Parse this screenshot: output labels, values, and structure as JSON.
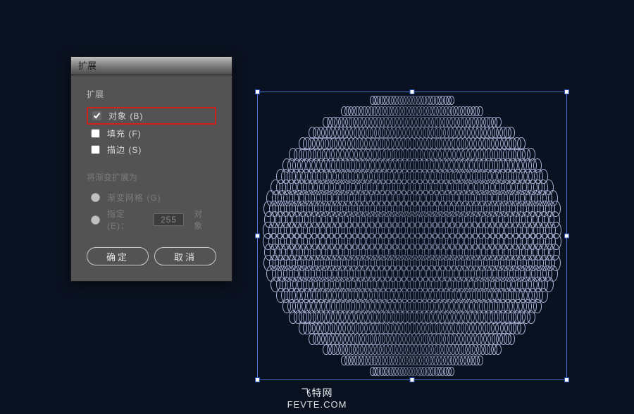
{
  "dialog": {
    "title": "扩展",
    "section1_label": "扩展",
    "object_label": "对象 (B)",
    "fill_label": "填充 (F)",
    "stroke_label": "描边 (S)",
    "section2_label": "将渐变扩展为",
    "gradient_mesh_label": "渐变网格 (G)",
    "specify_prefix": "指定 (E)：",
    "specify_value": "255",
    "specify_suffix": "对象",
    "ok": "确定",
    "cancel": "取消"
  },
  "artwork": {
    "rows": 26
  },
  "footer": {
    "name": "飞特网",
    "url": "FEVTE.COM"
  }
}
